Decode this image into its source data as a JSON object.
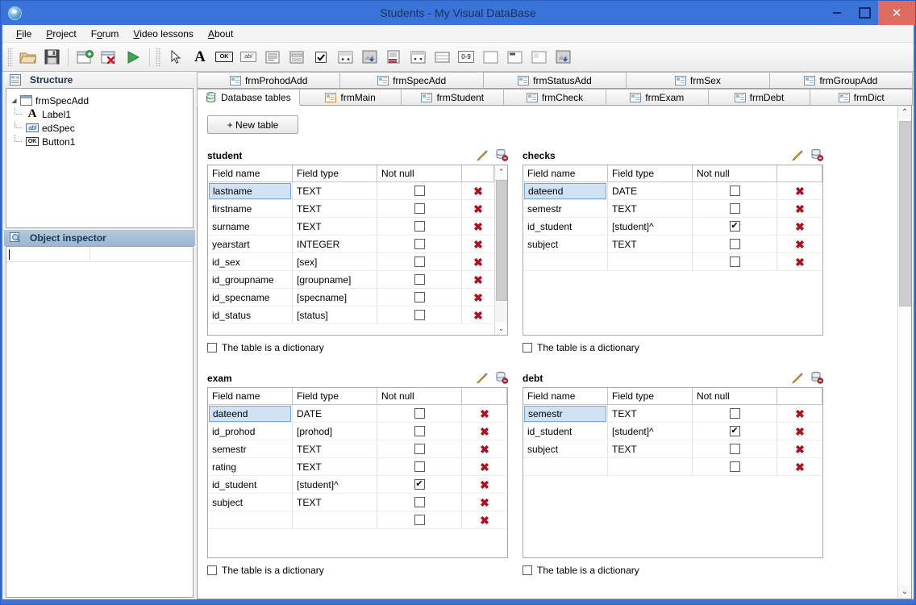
{
  "window": {
    "title": "Students - My Visual DataBase",
    "app_icon": "app-globe-icon",
    "minimize": "–",
    "maximize": "□",
    "close": "✕"
  },
  "menu": {
    "items": [
      {
        "label": "File"
      },
      {
        "label": "Project"
      },
      {
        "label": "Forum"
      },
      {
        "label": "Video lessons"
      },
      {
        "label": "About"
      }
    ]
  },
  "toolbar": {
    "groups": [
      {
        "buttons": [
          {
            "name": "open-project-icon",
            "glyph": "📂"
          },
          {
            "name": "save-project-icon",
            "glyph": "💾"
          }
        ]
      },
      {
        "buttons": [
          {
            "name": "add-form-icon",
            "glyph": "▣"
          },
          {
            "name": "delete-form-icon",
            "glyph": "▤"
          },
          {
            "name": "run-project-icon",
            "glyph": "▶"
          }
        ]
      },
      {
        "buttons": [
          {
            "name": "pointer-tool-icon",
            "glyph": "↖"
          },
          {
            "name": "label-tool-icon",
            "glyph": "A"
          },
          {
            "name": "button-tool-icon",
            "glyph": "OK"
          },
          {
            "name": "edit-tool-icon",
            "glyph": "abl"
          },
          {
            "name": "memo-tool-icon",
            "glyph": "▤"
          },
          {
            "name": "groupbox-tool-icon",
            "glyph": "▥"
          },
          {
            "name": "checkbox-tool-icon",
            "glyph": "☑"
          },
          {
            "name": "combobox-tool-icon",
            "glyph": "▦"
          },
          {
            "name": "image-tool-icon",
            "glyph": "▧"
          },
          {
            "name": "datasource-tool-icon",
            "glyph": "▨"
          },
          {
            "name": "grid-tool-icon",
            "glyph": "▩"
          },
          {
            "name": "table-tool-icon",
            "glyph": "▤"
          },
          {
            "name": "number-tool-icon",
            "glyph": "0-9"
          },
          {
            "name": "panel-tool-icon",
            "glyph": "▢"
          },
          {
            "name": "page-tool-icon",
            "glyph": "▣"
          },
          {
            "name": "report-tool-icon",
            "glyph": "▤"
          },
          {
            "name": "picture-tool-icon",
            "glyph": "▧"
          }
        ]
      }
    ]
  },
  "structure": {
    "title": "Structure",
    "icon": "structure-icon",
    "root": {
      "label": "frmSpecAdd",
      "icon": "form-icon",
      "expander": "◢"
    },
    "children": [
      {
        "label": "Label1",
        "icon": "label-icon"
      },
      {
        "label": "edSpec",
        "icon": "edit-icon"
      },
      {
        "label": "Button1",
        "icon": "button-icon"
      }
    ]
  },
  "object_inspector": {
    "title": "Object inspector",
    "icon": "inspector-icon",
    "rows": [
      {
        "key": "",
        "value": ""
      }
    ]
  },
  "tabs": {
    "top_row": [
      {
        "label": "frmProhodAdd",
        "icon": "form-icon",
        "active": false
      },
      {
        "label": "frmSpecAdd",
        "icon": "form-icon",
        "active": false
      },
      {
        "label": "frmStatusAdd",
        "icon": "form-icon",
        "active": false
      },
      {
        "label": "frmSex",
        "icon": "form-icon",
        "active": false
      },
      {
        "label": "frmGroupAdd",
        "icon": "form-icon",
        "active": false
      }
    ],
    "bottom_row": [
      {
        "label": "Database tables",
        "icon": "db-icon",
        "active": true
      },
      {
        "label": "frmMain",
        "icon": "form-icon-main",
        "active": false
      },
      {
        "label": "frmStudent",
        "icon": "form-icon",
        "active": false
      },
      {
        "label": "frmCheck",
        "icon": "form-icon",
        "active": false
      },
      {
        "label": "frmExam",
        "icon": "form-icon",
        "active": false
      },
      {
        "label": "frmDebt",
        "icon": "form-icon",
        "active": false
      },
      {
        "label": "frmDict",
        "icon": "form-icon",
        "active": false
      }
    ]
  },
  "content": {
    "new_table_button": "+ New table",
    "columns": [
      "Field name",
      "Field type",
      "Not null"
    ],
    "dictionary_label": "The table is a dictionary",
    "edit_icon": "pencil-edit-icon",
    "delete_icon": "database-delete-icon",
    "delete_row_glyph": "✖",
    "tables": [
      {
        "name": "student",
        "scrollable": true,
        "dictionary_checked": false,
        "rows": [
          {
            "field": "lastname",
            "type": "TEXT",
            "not_null": false,
            "selected": true
          },
          {
            "field": "firstname",
            "type": "TEXT",
            "not_null": false,
            "selected": false
          },
          {
            "field": "surname",
            "type": "TEXT",
            "not_null": false,
            "selected": false
          },
          {
            "field": "yearstart",
            "type": "INTEGER",
            "not_null": false,
            "selected": false
          },
          {
            "field": "id_sex",
            "type": "[sex]",
            "not_null": false,
            "selected": false
          },
          {
            "field": "id_groupname",
            "type": "[groupname]",
            "not_null": false,
            "selected": false
          },
          {
            "field": "id_specname",
            "type": "[specname]",
            "not_null": false,
            "selected": false
          },
          {
            "field": "id_status",
            "type": "[status]",
            "not_null": false,
            "selected": false
          }
        ]
      },
      {
        "name": "checks",
        "scrollable": false,
        "dictionary_checked": false,
        "rows": [
          {
            "field": "dateend",
            "type": "DATE",
            "not_null": false,
            "selected": true
          },
          {
            "field": "semestr",
            "type": "TEXT",
            "not_null": false,
            "selected": false
          },
          {
            "field": "id_student",
            "type": "[student]^",
            "not_null": true,
            "selected": false
          },
          {
            "field": "subject",
            "type": "TEXT",
            "not_null": false,
            "selected": false
          },
          {
            "field": "",
            "type": "",
            "not_null": false,
            "selected": false
          }
        ]
      },
      {
        "name": "exam",
        "scrollable": false,
        "dictionary_checked": false,
        "rows": [
          {
            "field": "dateend",
            "type": "DATE",
            "not_null": false,
            "selected": true
          },
          {
            "field": "id_prohod",
            "type": "[prohod]",
            "not_null": false,
            "selected": false
          },
          {
            "field": "semestr",
            "type": "TEXT",
            "not_null": false,
            "selected": false
          },
          {
            "field": "rating",
            "type": "TEXT",
            "not_null": false,
            "selected": false
          },
          {
            "field": "id_student",
            "type": "[student]^",
            "not_null": true,
            "selected": false
          },
          {
            "field": "subject",
            "type": "TEXT",
            "not_null": false,
            "selected": false
          },
          {
            "field": "",
            "type": "",
            "not_null": false,
            "selected": false
          }
        ]
      },
      {
        "name": "debt",
        "scrollable": false,
        "dictionary_checked": false,
        "rows": [
          {
            "field": "semestr",
            "type": "TEXT",
            "not_null": false,
            "selected": true
          },
          {
            "field": "id_student",
            "type": "[student]^",
            "not_null": true,
            "selected": false
          },
          {
            "field": "subject",
            "type": "TEXT",
            "not_null": false,
            "selected": false
          },
          {
            "field": "",
            "type": "",
            "not_null": false,
            "selected": false
          }
        ]
      }
    ]
  },
  "scrollbars": {
    "up_glyph": "⌃",
    "down_glyph": "⌄"
  },
  "colors": {
    "title_bar": "#3a74d8",
    "close_button": "#dd6b62",
    "selection": "#cfe3f5",
    "delete_x": "#b00f1e",
    "inspector_header": "#a6bdd6"
  }
}
